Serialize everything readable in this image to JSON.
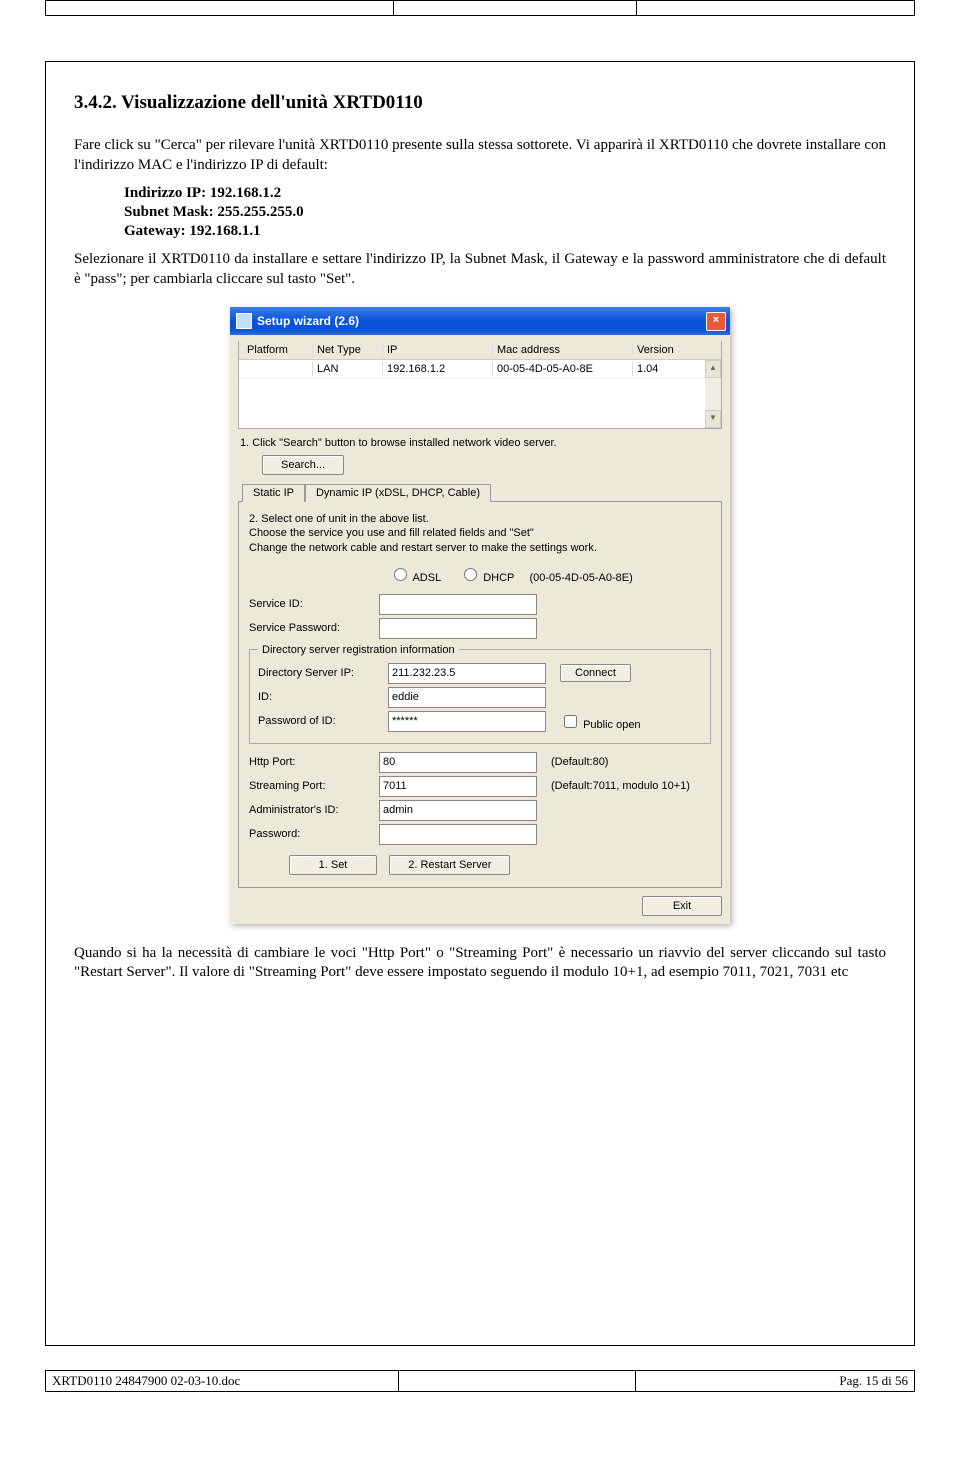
{
  "section": {
    "heading": "3.4.2. Visualizzazione dell'unità XRTD0110",
    "intro": "Fare click su \"Cerca\" per rilevare l'unità XRTD0110 presente sulla stessa sottorete. Vi apparirà il XRTD0110 che dovrete installare con l'indirizzo MAC e l'indirizzo IP di default:",
    "defaults": {
      "ip": "Indirizzo IP: 192.168.1.2",
      "mask": "Subnet Mask: 255.255.255.0",
      "gw": "Gateway: 192.168.1.1"
    },
    "para2": "Selezionare il XRTD0110 da installare e settare l'indirizzo IP, la Subnet Mask, il Gateway e la password amministratore che di default è \"pass\"; per cambiarla cliccare sul tasto \"Set\".",
    "outro": "Quando si ha la necessità di cambiare le voci \"Http Port\" o \"Streaming Port\" è necessario un riavvio del server cliccando sul tasto \"Restart Server\". Il valore di \"Streaming Port\" deve essere impostato seguendo il modulo 10+1, ad esempio 7011, 7021, 7031 etc"
  },
  "wizard": {
    "title": "Setup wizard (2.6)",
    "columns": {
      "platform": "Platform",
      "nettype": "Net Type",
      "ip": "IP",
      "mac": "Mac address",
      "version": "Version"
    },
    "row": {
      "platform": "",
      "nettype": "LAN",
      "ip": "192.168.1.2",
      "mac": "00-05-4D-05-A0-8E",
      "version": "1.04"
    },
    "step1": "1. Click \"Search\" button to browse installed network video server.",
    "search_btn": "Search...",
    "tabs": {
      "static": "Static IP",
      "dynamic": "Dynamic IP (xDSL, DHCP, Cable)"
    },
    "guide_lines": {
      "l1": "2. Select one of unit in the above list.",
      "l2": "Choose the service you use and fill related fields and \"Set\"",
      "l3": "Change the network cable and restart server to make the settings work."
    },
    "radios": {
      "adsl": "ADSL",
      "dhcp": "DHCP",
      "mac_display": "(00-05-4D-05-A0-8E)"
    },
    "labels": {
      "service_id": "Service ID:",
      "service_pwd": "Service Password:",
      "dir_title": "Directory server registration information",
      "dir_ip": "Directory Server IP:",
      "id": "ID:",
      "pwd_id": "Password of ID:",
      "connect": "Connect",
      "public": "Public open",
      "http_port": "Http Port:",
      "stream_port": "Streaming Port:",
      "admin_id": "Administrator's ID:",
      "password": "Password:",
      "default80": "(Default:80)",
      "default7011": "(Default:7011, modulo 10+1)",
      "set": "1. Set",
      "restart": "2. Restart Server",
      "exit": "Exit"
    },
    "values": {
      "dir_ip": "211.232.23.5",
      "id": "eddie",
      "pwd_id": "******",
      "http_port": "80",
      "stream_port": "7011",
      "admin_id": "admin"
    }
  },
  "footer": {
    "left": "XRTD0110 24847900 02-03-10.doc",
    "right": "Pag. 15 di 56"
  }
}
